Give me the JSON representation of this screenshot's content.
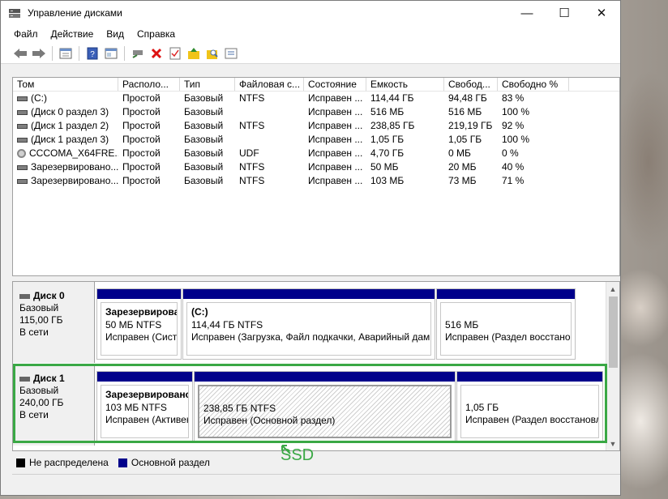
{
  "window": {
    "title": "Управление дисками",
    "controls": {
      "minimize": "—",
      "maximize": "☐",
      "close": "✕"
    }
  },
  "menu": [
    "Файл",
    "Действие",
    "Вид",
    "Справка"
  ],
  "volume_list": {
    "columns": [
      "Том",
      "Располо...",
      "Тип",
      "Файловая с...",
      "Состояние",
      "Емкость",
      "Свобод...",
      "Свободно %"
    ],
    "rows": [
      {
        "name": "(C:)",
        "icon": "volume",
        "layout": "Простой",
        "type": "Базовый",
        "fs": "NTFS",
        "status": "Исправен ...",
        "capacity": "114,44 ГБ",
        "free": "94,48 ГБ",
        "free_pct": "83 %"
      },
      {
        "name": "(Диск 0 раздел 3)",
        "icon": "volume",
        "layout": "Простой",
        "type": "Базовый",
        "fs": "",
        "status": "Исправен ...",
        "capacity": "516 МБ",
        "free": "516 МБ",
        "free_pct": "100 %"
      },
      {
        "name": "(Диск 1 раздел 2)",
        "icon": "volume",
        "layout": "Простой",
        "type": "Базовый",
        "fs": "NTFS",
        "status": "Исправен ...",
        "capacity": "238,85 ГБ",
        "free": "219,19 ГБ",
        "free_pct": "92 %"
      },
      {
        "name": "(Диск 1 раздел 3)",
        "icon": "volume",
        "layout": "Простой",
        "type": "Базовый",
        "fs": "",
        "status": "Исправен ...",
        "capacity": "1,05 ГБ",
        "free": "1,05 ГБ",
        "free_pct": "100 %"
      },
      {
        "name": "CCCOMA_X64FRE...",
        "icon": "cd",
        "layout": "Простой",
        "type": "Базовый",
        "fs": "UDF",
        "status": "Исправен ...",
        "capacity": "4,70 ГБ",
        "free": "0 МБ",
        "free_pct": "0 %"
      },
      {
        "name": "Зарезервировано...",
        "icon": "volume",
        "layout": "Простой",
        "type": "Базовый",
        "fs": "NTFS",
        "status": "Исправен ...",
        "capacity": "50 МБ",
        "free": "20 МБ",
        "free_pct": "40 %"
      },
      {
        "name": "Зарезервировано...",
        "icon": "volume",
        "layout": "Простой",
        "type": "Базовый",
        "fs": "NTFS",
        "status": "Исправен ...",
        "capacity": "103 МБ",
        "free": "73 МБ",
        "free_pct": "71 %"
      }
    ]
  },
  "disks": [
    {
      "name": "Диск 0",
      "type": "Базовый",
      "size": "115,00 ГБ",
      "state": "В сети",
      "partitions": [
        {
          "title": "Зарезервирова",
          "size": "50 МБ NTFS",
          "status": "Исправен (Систе"
        },
        {
          "title": "(C:)",
          "size": "114,44 ГБ NTFS",
          "status": "Исправен (Загрузка, Файл подкачки, Аварийный дамп"
        },
        {
          "title": "",
          "size": "516 МБ",
          "status": "Исправен (Раздел восстанов"
        }
      ]
    },
    {
      "name": "Диск 1",
      "type": "Базовый",
      "size": "240,00 ГБ",
      "state": "В сети",
      "partitions": [
        {
          "title": "Зарезервировано",
          "size": "103 МБ NTFS",
          "status": "Исправен (Активен"
        },
        {
          "title": "",
          "size": "238,85 ГБ NTFS",
          "status": "Исправен (Основной раздел)"
        },
        {
          "title": "",
          "size": "1,05 ГБ",
          "status": "Исправен (Раздел восстановле"
        }
      ]
    }
  ],
  "legend": [
    {
      "label": "Не распределена",
      "color": "#000000"
    },
    {
      "label": "Основной раздел",
      "color": "#00008b"
    }
  ],
  "annotation": {
    "text": "SSD",
    "color": "#3aa845"
  },
  "toolbar_icons": [
    "back-arrow-icon",
    "forward-arrow-icon",
    "properties-icon",
    "help-icon",
    "connect-icon",
    "delete-icon",
    "checklist-icon",
    "folder-up-icon",
    "search-folder-icon",
    "settings-list-icon"
  ]
}
